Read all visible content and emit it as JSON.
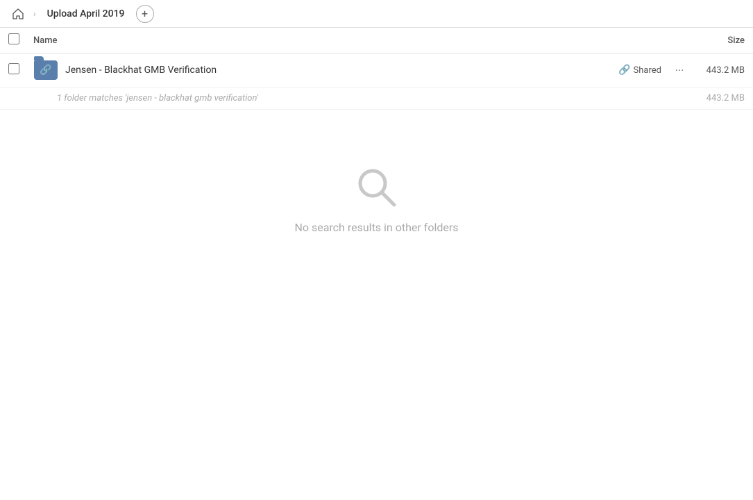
{
  "topbar": {
    "home_icon": "home",
    "breadcrumb_label": "Upload April 2019",
    "add_icon": "plus"
  },
  "table": {
    "col_name": "Name",
    "col_size": "Size"
  },
  "file_row": {
    "name": "Jensen - Blackhat GMB Verification",
    "shared_label": "Shared",
    "more_icon": "ellipsis",
    "size": "443.2 MB",
    "link_icon": "🔗"
  },
  "match_row": {
    "text": "1 folder matches 'jensen - blackhat gmb verification'",
    "size": "443.2 MB"
  },
  "empty_state": {
    "message": "No search results in other folders"
  }
}
